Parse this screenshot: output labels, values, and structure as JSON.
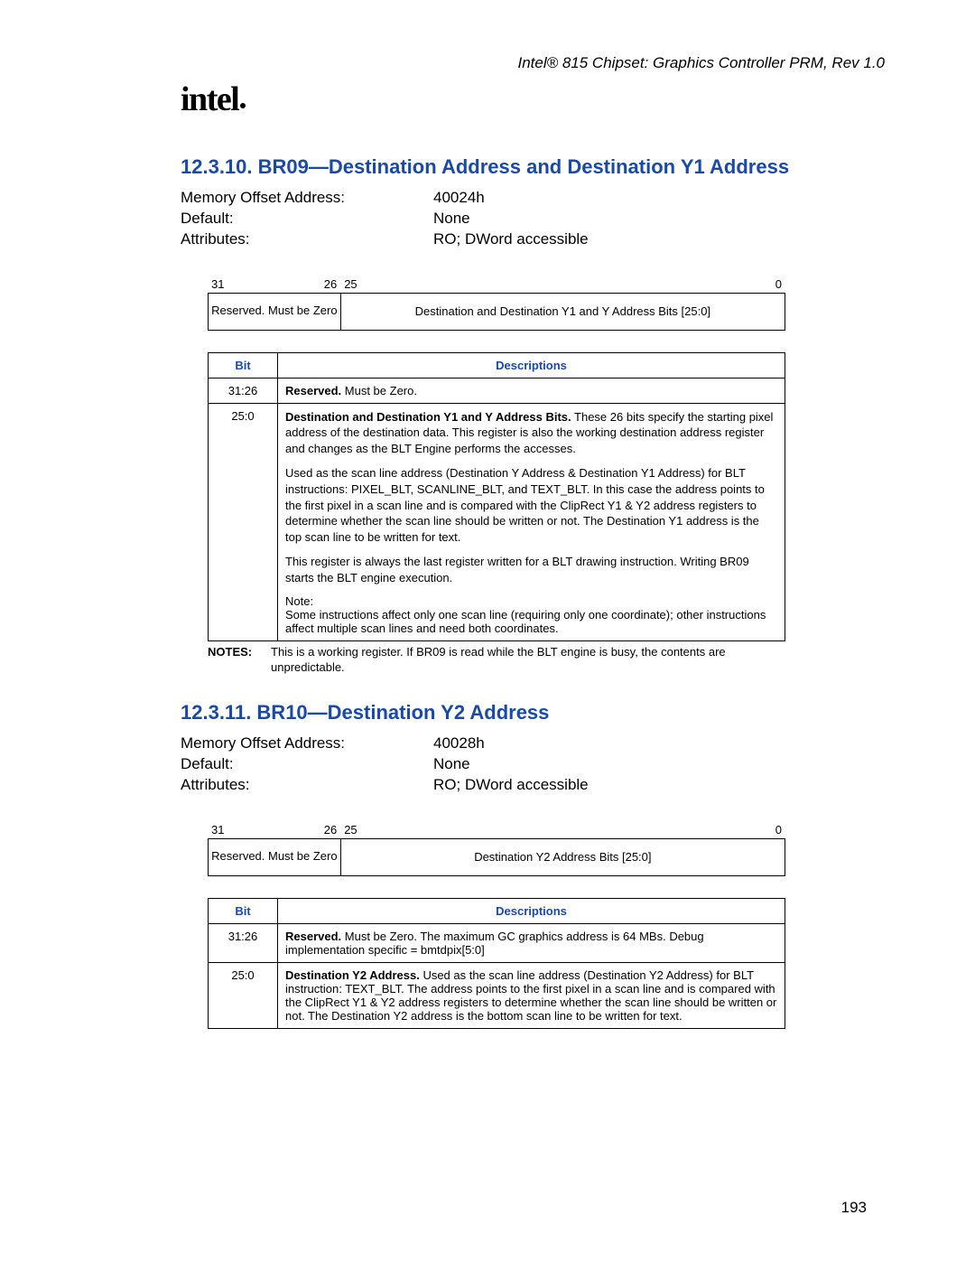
{
  "header": {
    "doc_title": "Intel® 815 Chipset: Graphics Controller PRM, Rev 1.0",
    "logo_text": "intel"
  },
  "section1": {
    "number_title": "12.3.10.  BR09—Destination Address and Destination Y1 Address",
    "kv": {
      "mem_label": "Memory Offset Address:",
      "mem_val": "40024h",
      "def_label": "Default:",
      "def_val": "None",
      "attr_label": "Attributes:",
      "attr_val": "RO; DWord accessible"
    },
    "diagram": {
      "b31": "31",
      "b26": "26",
      "b25": "25",
      "b0": "0",
      "left": "Reserved. Must be Zero",
      "right": "Destination and Destination Y1 and Y Address Bits [25:0]"
    },
    "table": {
      "col_bit": "Bit",
      "col_desc": "Descriptions",
      "rows": [
        {
          "bit": "31:26",
          "desc_bold": "Reserved.",
          "desc_rest": " Must be Zero."
        },
        {
          "bit": "25:0",
          "desc_bold": "Destination and Destination Y1 and Y Address Bits.",
          "desc_rest": " These 26 bits specify the starting pixel address of the destination data. This register is also the working destination address register and changes as the BLT Engine performs the accesses.",
          "p2": "Used as the scan line address (Destination Y Address & Destination Y1 Address) for BLT instructions: PIXEL_BLT, SCANLINE_BLT, and TEXT_BLT. In this case the address points to the first pixel in a scan line and is compared with the ClipRect Y1 & Y2 address registers to determine whether the scan line should be written or not. The Destination Y1 address is the top scan line to be written for text.",
          "p3": "This register is always the last register written for a BLT drawing instruction. Writing BR09 starts the BLT engine execution.",
          "p4a": "Note:",
          "p4b": "Some instructions affect only one scan line (requiring only one coordinate); other instructions affect multiple scan lines and need both coordinates."
        }
      ]
    },
    "notes_label": "NOTES:",
    "notes_text": "This is a working register. If BR09 is read while the BLT engine is busy, the contents are unpredictable."
  },
  "section2": {
    "number_title": "12.3.11.  BR10—Destination Y2 Address",
    "kv": {
      "mem_label": "Memory Offset Address:",
      "mem_val": "40028h",
      "def_label": "Default:",
      "def_val": "None",
      "attr_label": "Attributes:",
      "attr_val": "RO; DWord accessible"
    },
    "diagram": {
      "b31": "31",
      "b26": "26",
      "b25": "25",
      "b0": "0",
      "left": "Reserved. Must be Zero",
      "right": "Destination Y2 Address Bits [25:0]"
    },
    "table": {
      "col_bit": "Bit",
      "col_desc": "Descriptions",
      "rows": [
        {
          "bit": "31:26",
          "desc_bold": "Reserved.",
          "desc_rest": " Must be Zero. The maximum GC graphics address is 64 MBs. Debug implementation specific = bmtdpix[5:0]"
        },
        {
          "bit": "25:0",
          "desc_bold": "Destination Y2 Address.",
          "desc_rest": " Used as the scan line address (Destination Y2 Address) for BLT instruction: TEXT_BLT. The address points to the first pixel in a scan line and is compared with the ClipRect Y1 & Y2 address registers to determine whether the scan line should be written or not. The Destination Y2 address is the bottom scan line to be written for text."
        }
      ]
    }
  },
  "page_number": "193"
}
